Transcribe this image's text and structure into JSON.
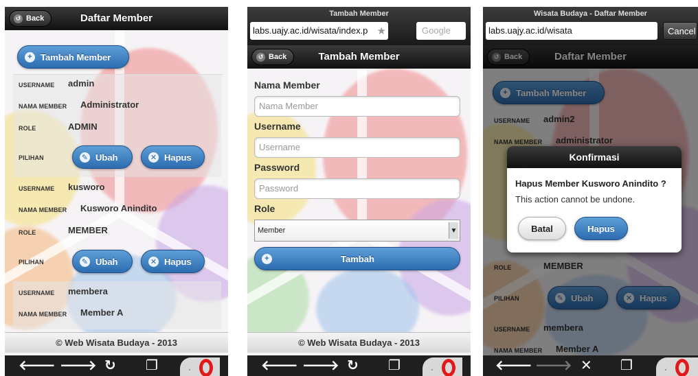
{
  "screen1": {
    "back_label": "Back",
    "title": "Daftar Member",
    "add_button": "Tambah Member",
    "members": [
      {
        "username_label": "USERNAME",
        "username": "admin",
        "nama_label": "NAMA MEMBER",
        "nama": "Administrator",
        "role_label": "ROLE",
        "role": "ADMIN",
        "pilihan_label": "PILIHAN",
        "edit": "Ubah",
        "delete": "Hapus"
      },
      {
        "username_label": "USERNAME",
        "username": "kusworo",
        "nama_label": "NAMA MEMBER",
        "nama": "Kusworo Anindito",
        "role_label": "ROLE",
        "role": "MEMBER",
        "pilihan_label": "PILIHAN",
        "edit": "Ubah",
        "delete": "Hapus"
      },
      {
        "username_label": "USERNAME",
        "username": "membera",
        "nama_label": "NAMA MEMBER",
        "nama": "Member A"
      }
    ],
    "footer": "© Web Wisata Budaya - 2013"
  },
  "screen2": {
    "window_title": "Tambah Member",
    "url": "labs.uajy.ac.id/wisata/index.p",
    "search_placeholder": "Google",
    "back_label": "Back",
    "title": "Tambah Member",
    "fields": {
      "nama_label": "Nama Member",
      "nama_placeholder": "Nama Member",
      "username_label": "Username",
      "username_placeholder": "Username",
      "password_label": "Password",
      "password_placeholder": "Password",
      "role_label": "Role",
      "role_value": "Member"
    },
    "submit": "Tambah",
    "footer": "© Web Wisata Budaya - 2013"
  },
  "screen3": {
    "window_title": "Wisata Budaya - Daftar Member",
    "url": "labs.uajy.ac.id/wisata",
    "cancel": "Cancel",
    "back_label": "Back",
    "title": "Daftar Member",
    "add_button": "Tambah Member",
    "members": [
      {
        "username_label": "USERNAME",
        "username": "admin2",
        "nama_label": "NAMA MEMBER",
        "nama": "administrator"
      },
      {
        "role_label": "ROLE",
        "role": "MEMBER",
        "pilihan_label": "PILIHAN",
        "edit": "Ubah",
        "delete": "Hapus"
      },
      {
        "username_label": "USERNAME",
        "username": "membera",
        "nama_label": "NAMA MEMBER",
        "nama": "Member A"
      }
    ],
    "dialog": {
      "title": "Konfirmasi",
      "question": "Hapus Member Kusworo Anindito ?",
      "message": "This action cannot be undone.",
      "cancel": "Batal",
      "confirm": "Hapus"
    }
  },
  "colors": {
    "accent_blue": "#2c6cb0",
    "header_dark": "#111111",
    "opera_red": "#e01a1a"
  }
}
